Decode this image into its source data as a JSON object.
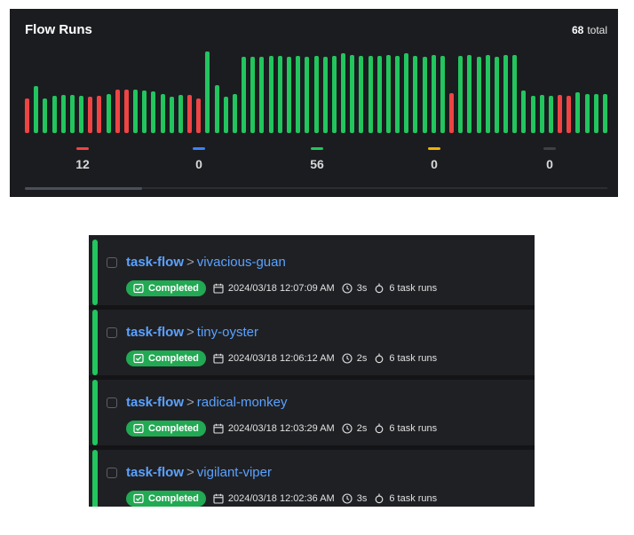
{
  "flow_runs": {
    "title": "Flow Runs",
    "total_count": "68",
    "total_label": "total",
    "history": [
      {
        "state": "failed",
        "level": 0.42
      },
      {
        "state": "completed",
        "level": 0.56
      },
      {
        "state": "completed",
        "level": 0.42
      },
      {
        "state": "completed",
        "level": 0.45
      },
      {
        "state": "completed",
        "level": 0.46
      },
      {
        "state": "completed",
        "level": 0.46
      },
      {
        "state": "completed",
        "level": 0.45
      },
      {
        "state": "failed",
        "level": 0.44
      },
      {
        "state": "failed",
        "level": 0.45
      },
      {
        "state": "completed",
        "level": 0.47
      },
      {
        "state": "failed",
        "level": 0.52
      },
      {
        "state": "failed",
        "level": 0.52
      },
      {
        "state": "completed",
        "level": 0.52
      },
      {
        "state": "completed",
        "level": 0.51
      },
      {
        "state": "completed",
        "level": 0.5
      },
      {
        "state": "completed",
        "level": 0.47
      },
      {
        "state": "completed",
        "level": 0.44
      },
      {
        "state": "completed",
        "level": 0.46
      },
      {
        "state": "failed",
        "level": 0.46
      },
      {
        "state": "failed",
        "level": 0.42
      },
      {
        "state": "completed",
        "level": 0.98
      },
      {
        "state": "completed",
        "level": 0.57
      },
      {
        "state": "completed",
        "level": 0.44
      },
      {
        "state": "completed",
        "level": 0.47
      },
      {
        "state": "completed",
        "level": 0.92
      },
      {
        "state": "completed",
        "level": 0.92
      },
      {
        "state": "completed",
        "level": 0.92
      },
      {
        "state": "completed",
        "level": 0.93
      },
      {
        "state": "completed",
        "level": 0.93
      },
      {
        "state": "completed",
        "level": 0.92
      },
      {
        "state": "completed",
        "level": 0.93
      },
      {
        "state": "completed",
        "level": 0.92
      },
      {
        "state": "completed",
        "level": 0.93
      },
      {
        "state": "completed",
        "level": 0.92
      },
      {
        "state": "completed",
        "level": 0.93
      },
      {
        "state": "completed",
        "level": 0.96
      },
      {
        "state": "completed",
        "level": 0.94
      },
      {
        "state": "completed",
        "level": 0.93
      },
      {
        "state": "completed",
        "level": 0.93
      },
      {
        "state": "completed",
        "level": 0.93
      },
      {
        "state": "completed",
        "level": 0.94
      },
      {
        "state": "completed",
        "level": 0.93
      },
      {
        "state": "completed",
        "level": 0.96
      },
      {
        "state": "completed",
        "level": 0.93
      },
      {
        "state": "completed",
        "level": 0.92
      },
      {
        "state": "completed",
        "level": 0.94
      },
      {
        "state": "completed",
        "level": 0.93
      },
      {
        "state": "failed",
        "level": 0.48
      },
      {
        "state": "completed",
        "level": 0.93
      },
      {
        "state": "completed",
        "level": 0.94
      },
      {
        "state": "completed",
        "level": 0.92
      },
      {
        "state": "completed",
        "level": 0.94
      },
      {
        "state": "completed",
        "level": 0.92
      },
      {
        "state": "completed",
        "level": 0.94
      },
      {
        "state": "completed",
        "level": 0.94
      },
      {
        "state": "completed",
        "level": 0.51
      },
      {
        "state": "completed",
        "level": 0.45
      },
      {
        "state": "completed",
        "level": 0.46
      },
      {
        "state": "completed",
        "level": 0.45
      },
      {
        "state": "failed",
        "level": 0.46
      },
      {
        "state": "failed",
        "level": 0.45
      },
      {
        "state": "completed",
        "level": 0.49
      },
      {
        "state": "completed",
        "level": 0.47
      },
      {
        "state": "completed",
        "level": 0.47
      },
      {
        "state": "completed",
        "level": 0.47
      }
    ],
    "state_counts": [
      {
        "state": "failed",
        "value": "12",
        "color": "#ef4444"
      },
      {
        "state": "running",
        "value": "0",
        "color": "#3b82f6"
      },
      {
        "state": "completed",
        "value": "56",
        "color": "#22c55e"
      },
      {
        "state": "pending",
        "value": "0",
        "color": "#eab308"
      },
      {
        "state": "cancelled",
        "value": "0",
        "color": "#3f4047"
      }
    ],
    "colors": {
      "completed": "#22c55e",
      "failed": "#ef4444"
    }
  },
  "runs": [
    {
      "flow": "task-flow",
      "name": "vivacious-guan",
      "status": "Completed",
      "date": "2024/03/18 12:07:09 AM",
      "duration": "3s",
      "task_runs": "6 task runs"
    },
    {
      "flow": "task-flow",
      "name": "tiny-oyster",
      "status": "Completed",
      "date": "2024/03/18 12:06:12 AM",
      "duration": "2s",
      "task_runs": "6 task runs"
    },
    {
      "flow": "task-flow",
      "name": "radical-monkey",
      "status": "Completed",
      "date": "2024/03/18 12:03:29 AM",
      "duration": "2s",
      "task_runs": "6 task runs"
    },
    {
      "flow": "task-flow",
      "name": "vigilant-viper",
      "status": "Completed",
      "date": "2024/03/18 12:02:36 AM",
      "duration": "3s",
      "task_runs": "6 task runs"
    }
  ],
  "separator": ">",
  "icons": {
    "status": "check-square-icon",
    "date": "calendar-icon",
    "duration": "clock-icon",
    "task_runs": "task-run-icon"
  }
}
